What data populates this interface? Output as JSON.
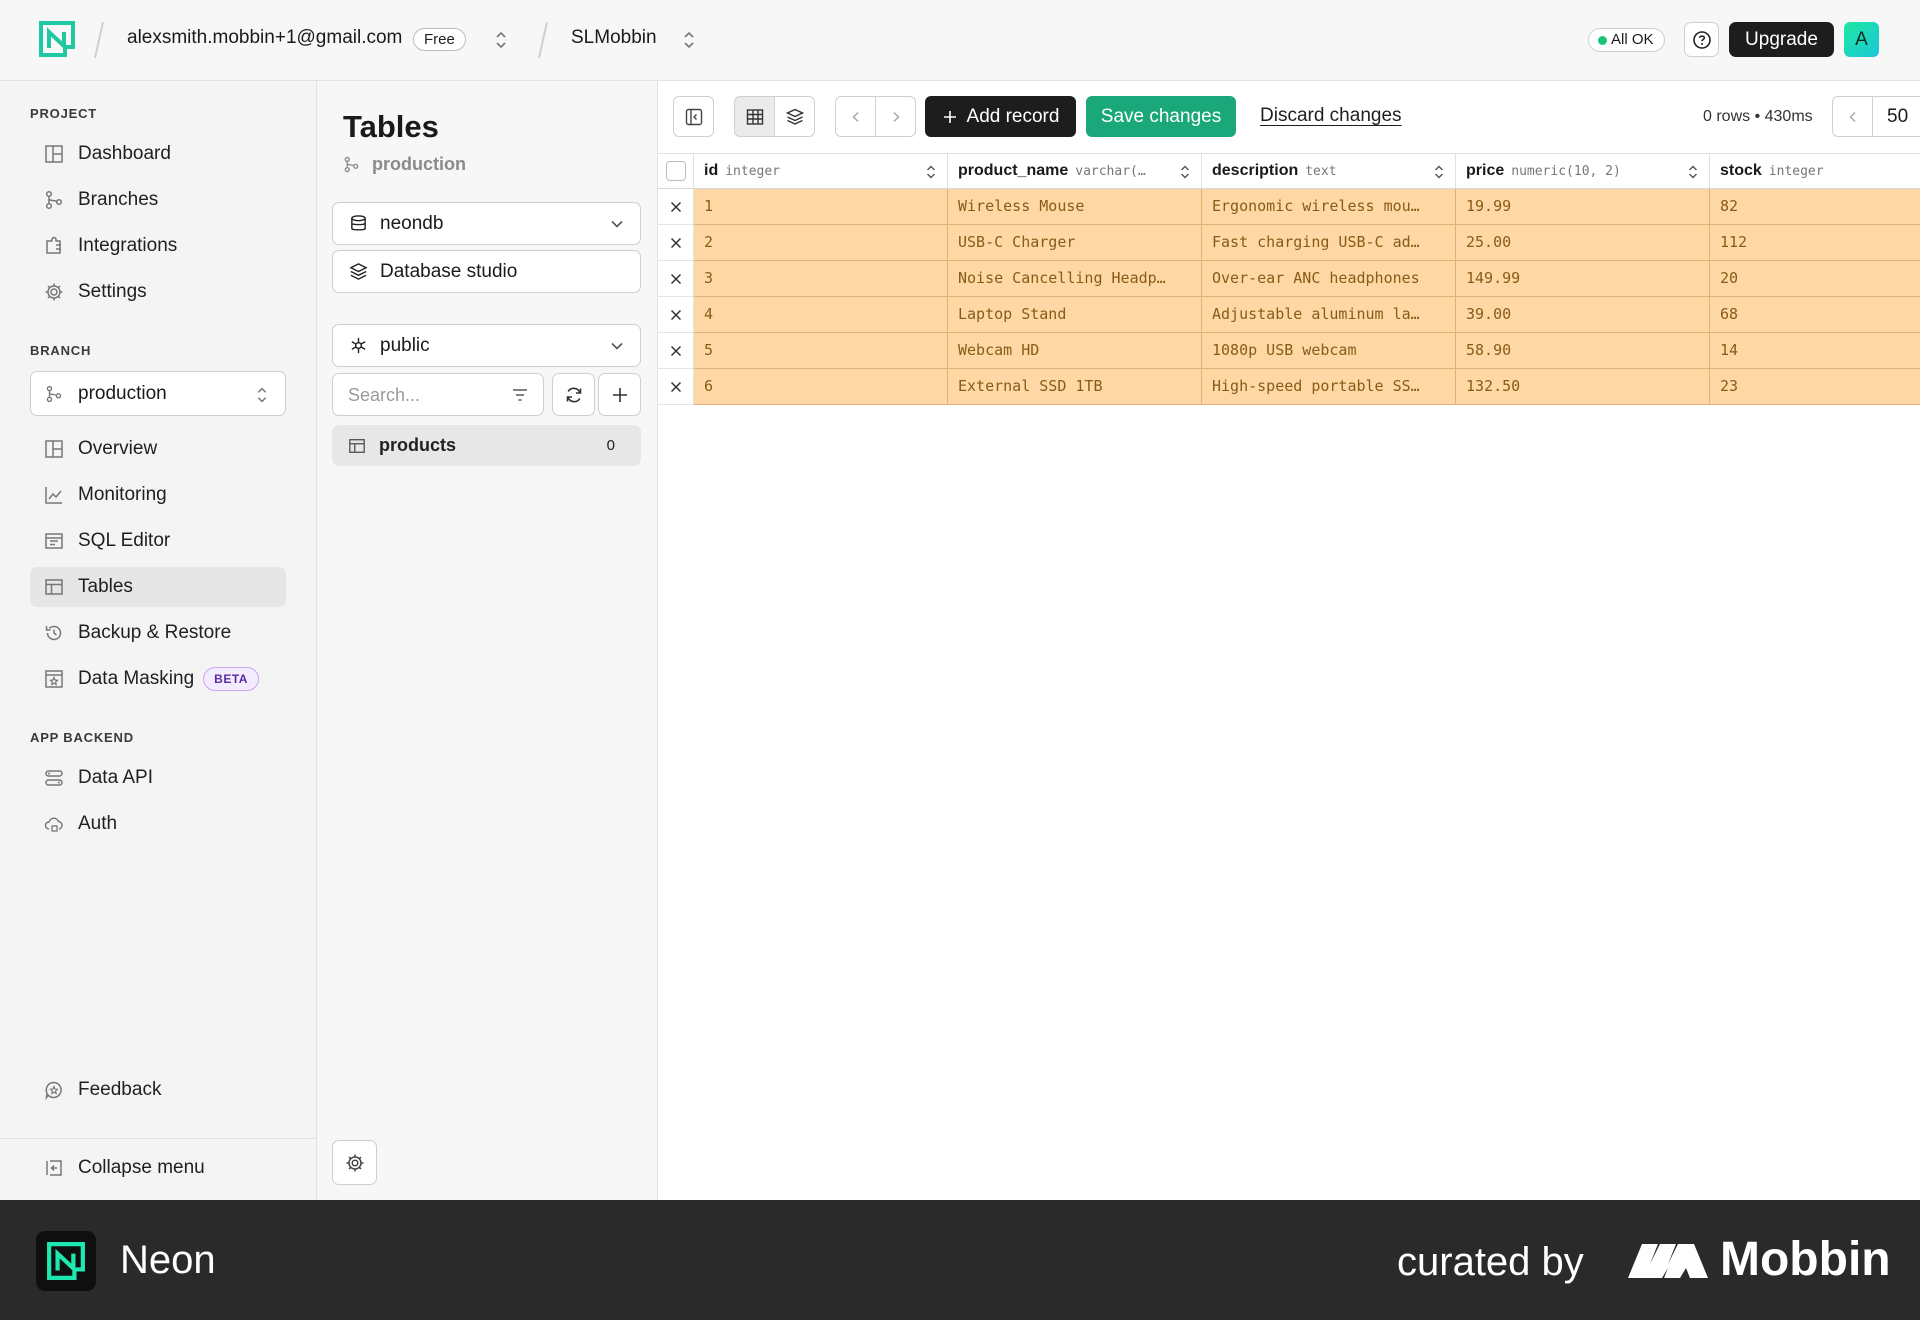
{
  "topbar": {
    "account_email": "alexsmith.mobbin+1@gmail.com",
    "plan_badge": "Free",
    "project_name": "SLMobbin",
    "status_label": "All OK",
    "help_icon": "question-icon",
    "upgrade_label": "Upgrade",
    "avatar_initial": "A"
  },
  "sidebar": {
    "project_label": "PROJECT",
    "project_items": [
      {
        "label": "Dashboard",
        "icon": "dashboard-icon"
      },
      {
        "label": "Branches",
        "icon": "branch-icon"
      },
      {
        "label": "Integrations",
        "icon": "puzzle-icon"
      },
      {
        "label": "Settings",
        "icon": "gear-icon"
      }
    ],
    "branch_label": "BRANCH",
    "branch_selected": "production",
    "branch_items": [
      {
        "label": "Overview",
        "icon": "dashboard-icon"
      },
      {
        "label": "Monitoring",
        "icon": "chart-icon"
      },
      {
        "label": "SQL Editor",
        "icon": "terminal-icon"
      },
      {
        "label": "Tables",
        "icon": "table-icon",
        "active": true
      },
      {
        "label": "Backup & Restore",
        "icon": "history-icon"
      },
      {
        "label": "Data Masking",
        "icon": "mask-icon",
        "badge": "BETA"
      }
    ],
    "app_backend_label": "APP BACKEND",
    "app_backend_items": [
      {
        "label": "Data API",
        "icon": "api-icon"
      },
      {
        "label": "Auth",
        "icon": "cloud-lock-icon"
      }
    ],
    "feedback_label": "Feedback",
    "collapse_label": "Collapse menu"
  },
  "tables_panel": {
    "title": "Tables",
    "branch": "production",
    "database": "neondb",
    "studio_label": "Database studio",
    "schema": "public",
    "search_placeholder": "Search...",
    "tables": [
      {
        "name": "products",
        "count": "0"
      }
    ]
  },
  "toolbar": {
    "add_record_label": "Add record",
    "save_label": "Save changes",
    "discard_label": "Discard changes",
    "rows_info": "0 rows • 430ms",
    "page_size": "50"
  },
  "grid": {
    "columns": [
      {
        "name": "id",
        "type": "integer"
      },
      {
        "name": "product_name",
        "type": "varchar(…"
      },
      {
        "name": "description",
        "type": "text"
      },
      {
        "name": "price",
        "type": "numeric(10, 2)"
      },
      {
        "name": "stock",
        "type": "integer"
      }
    ],
    "rows": [
      [
        "1",
        "Wireless Mouse",
        "Ergonomic wireless mou…",
        "19.99",
        "82"
      ],
      [
        "2",
        "USB-C Charger",
        "Fast charging USB-C ad…",
        "25.00",
        "112"
      ],
      [
        "3",
        "Noise Cancelling Headp…",
        "Over-ear ANC headphones",
        "149.99",
        "20"
      ],
      [
        "4",
        "Laptop Stand",
        "Adjustable aluminum la…",
        "39.00",
        "68"
      ],
      [
        "5",
        "Webcam HD",
        "1080p USB webcam",
        "58.90",
        "14"
      ],
      [
        "6",
        "External SSD 1TB",
        "High-speed portable SS…",
        "132.50",
        "23"
      ]
    ]
  },
  "footer": {
    "brand": "Neon",
    "curated_by": "curated by",
    "mobbin": "Mobbin"
  },
  "colors": {
    "accent_green": "#1aa87a",
    "pending_row": "#fdd8a4",
    "status_ok": "#1ec27a"
  }
}
